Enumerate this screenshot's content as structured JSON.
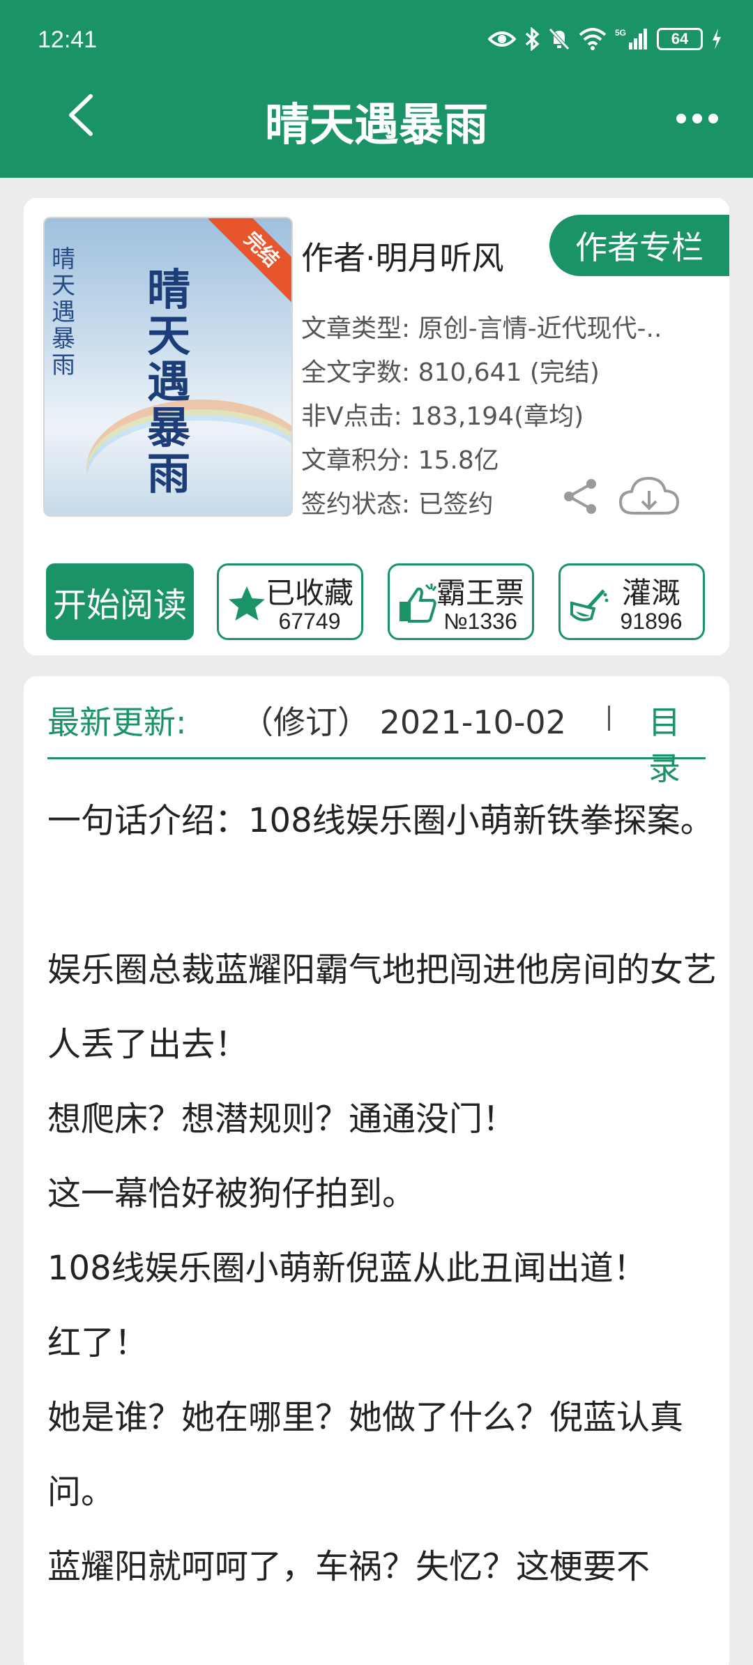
{
  "status": {
    "time": "12:41",
    "battery": "64",
    "signal_label": "5G"
  },
  "nav": {
    "title": "晴天遇暴雨"
  },
  "book": {
    "cover_badge": "完结",
    "cover_title": "晴天遇暴雨",
    "author": "作者·明月听风",
    "author_button": "作者专栏",
    "meta": [
      "文章类型: 原创-言情-近代现代-..",
      "全文字数: 810,641 (完结)",
      "非V点击: 183,194(章均)",
      "文章积分: 15.8亿",
      "签约状态: 已签约"
    ]
  },
  "actions": {
    "start_read": "开始阅读",
    "buttons": [
      {
        "label": "已收藏",
        "value": "67749",
        "icon": "star-icon"
      },
      {
        "label": "霸王票",
        "value": "№1336",
        "icon": "thumbs-up-icon"
      },
      {
        "label": "灌溉",
        "value": "91896",
        "icon": "watering-can-icon"
      }
    ]
  },
  "update": {
    "label": "最新更新:",
    "text": "（修订） 2021-10-02",
    "toc": "目录"
  },
  "intro": {
    "lines": [
      "一句话介绍：108线娱乐圈小萌新铁拳探案。",
      "",
      "娱乐圈总裁蓝耀阳霸气地把闯进他房间的女艺人丢了出去！",
      "想爬床？想潜规则？通通没门！",
      "这一幕恰好被狗仔拍到。",
      "108线娱乐圈小萌新倪蓝从此丑闻出道！",
      "红了！",
      "她是谁？她在哪里？她做了什么？倪蓝认真问。",
      "蓝耀阳就呵呵了，车祸？失忆？这梗要不"
    ]
  },
  "colors": {
    "brand": "#1a9466",
    "ribbon": "#e8542c"
  }
}
